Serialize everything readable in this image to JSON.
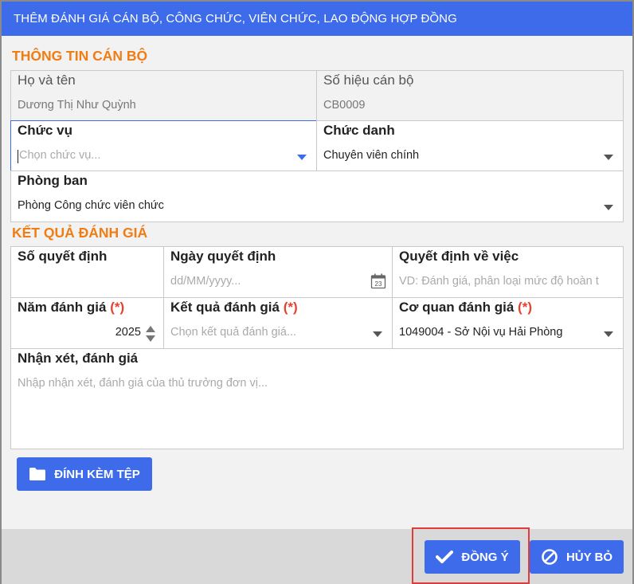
{
  "header": {
    "title": "THÊM ĐÁNH GIÁ CÁN BỘ, CÔNG CHỨC, VIÊN CHỨC, LAO ĐỘNG HỢP ĐỒNG"
  },
  "section_info": {
    "title": "THÔNG TIN CÁN BỘ",
    "full_name": {
      "label": "Họ và tên",
      "value": "Dương Thị Như Quỳnh"
    },
    "staff_code": {
      "label": "Số hiệu cán bộ",
      "value": "CB0009"
    },
    "position": {
      "label": "Chức vụ",
      "placeholder": "Chọn chức vụ..."
    },
    "title_field": {
      "label": "Chức danh",
      "value": "Chuyên viên chính"
    },
    "department": {
      "label": "Phòng ban",
      "value": "Phòng Công chức viên chức"
    }
  },
  "section_result": {
    "title": "KẾT QUẢ ĐÁNH GIÁ",
    "decision_no": {
      "label": "Số quyết định",
      "value": ""
    },
    "decision_date": {
      "label": "Ngày quyết định",
      "placeholder": "dd/MM/yyyy...",
      "calendar_day": "23"
    },
    "decision_about": {
      "label": "Quyết định về việc",
      "placeholder": "VD: Đánh giá, phân loại mức độ hoàn t"
    },
    "year": {
      "label": "Năm đánh giá",
      "required": "(*)",
      "value": "2025"
    },
    "result": {
      "label": "Kết quả đánh giá",
      "required": "(*)",
      "placeholder": "Chọn kết quả đánh giá..."
    },
    "agency": {
      "label": "Cơ quan đánh giá",
      "required": "(*)",
      "value": "1049004 - Sở Nội vụ Hải Phòng"
    },
    "comment": {
      "label": "Nhận xét, đánh giá",
      "placeholder": "Nhập nhận xét, đánh giá của thủ trưởng đơn vị..."
    }
  },
  "attach": {
    "label": "ĐÍNH KÈM TỆP"
  },
  "footer": {
    "ok_label": "ĐỒNG Ý",
    "cancel_label": "HỦY BỎ"
  },
  "colors": {
    "primary": "#3d6bea",
    "section": "#f07d14",
    "required": "#e8402f",
    "highlight": "#e23b3b"
  }
}
